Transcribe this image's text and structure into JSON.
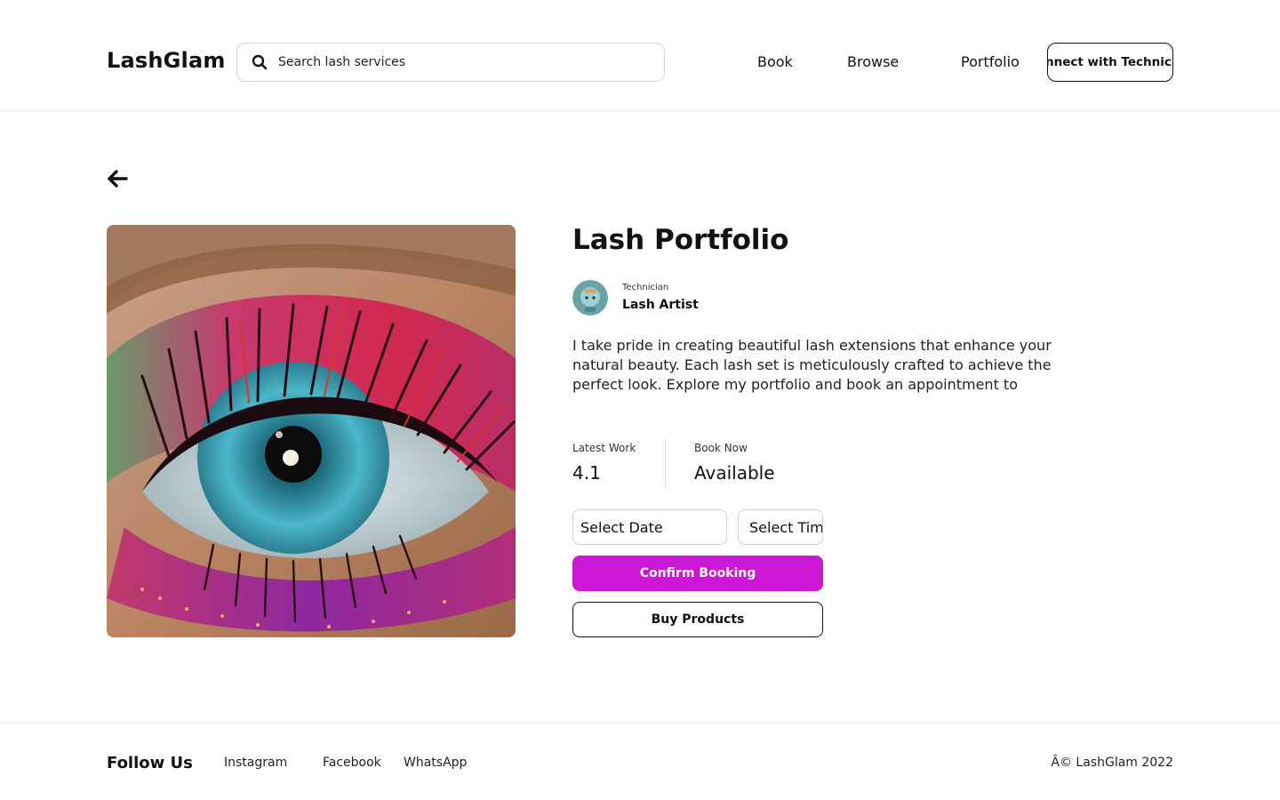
{
  "header": {
    "logo": "LashGlam",
    "search_placeholder": "Search lash services",
    "nav": [
      "Book",
      "Browse",
      "Portfolio"
    ],
    "connect_label": "Connect with Technician"
  },
  "main": {
    "title": "Lash Portfolio",
    "technician_label": "Technician",
    "technician_name": "Lash Artist",
    "bio": "I take pride in creating beautiful lash extensions that enhance your natural beauty. Each lash set is meticulously crafted to achieve the perfect look. Explore my portfolio and book an appointment to",
    "stats": [
      {
        "label": "Latest Work",
        "value": "4.1"
      },
      {
        "label": "Book Now",
        "value": "Available"
      }
    ],
    "date_field": "Select Date",
    "time_field": "Select Time",
    "confirm_label": "Confirm Booking",
    "buy_label": "Buy Products"
  },
  "footer": {
    "follow_label": "Follow Us",
    "social": [
      "Instagram",
      "Facebook",
      "WhatsApp"
    ],
    "copyright": "Â© LashGlam 2022"
  },
  "colors": {
    "accent": "#cc17d4",
    "text": "#111111",
    "border": "#d6d6d6"
  },
  "icons": {
    "search": "search-icon",
    "back": "arrow-left-icon"
  }
}
